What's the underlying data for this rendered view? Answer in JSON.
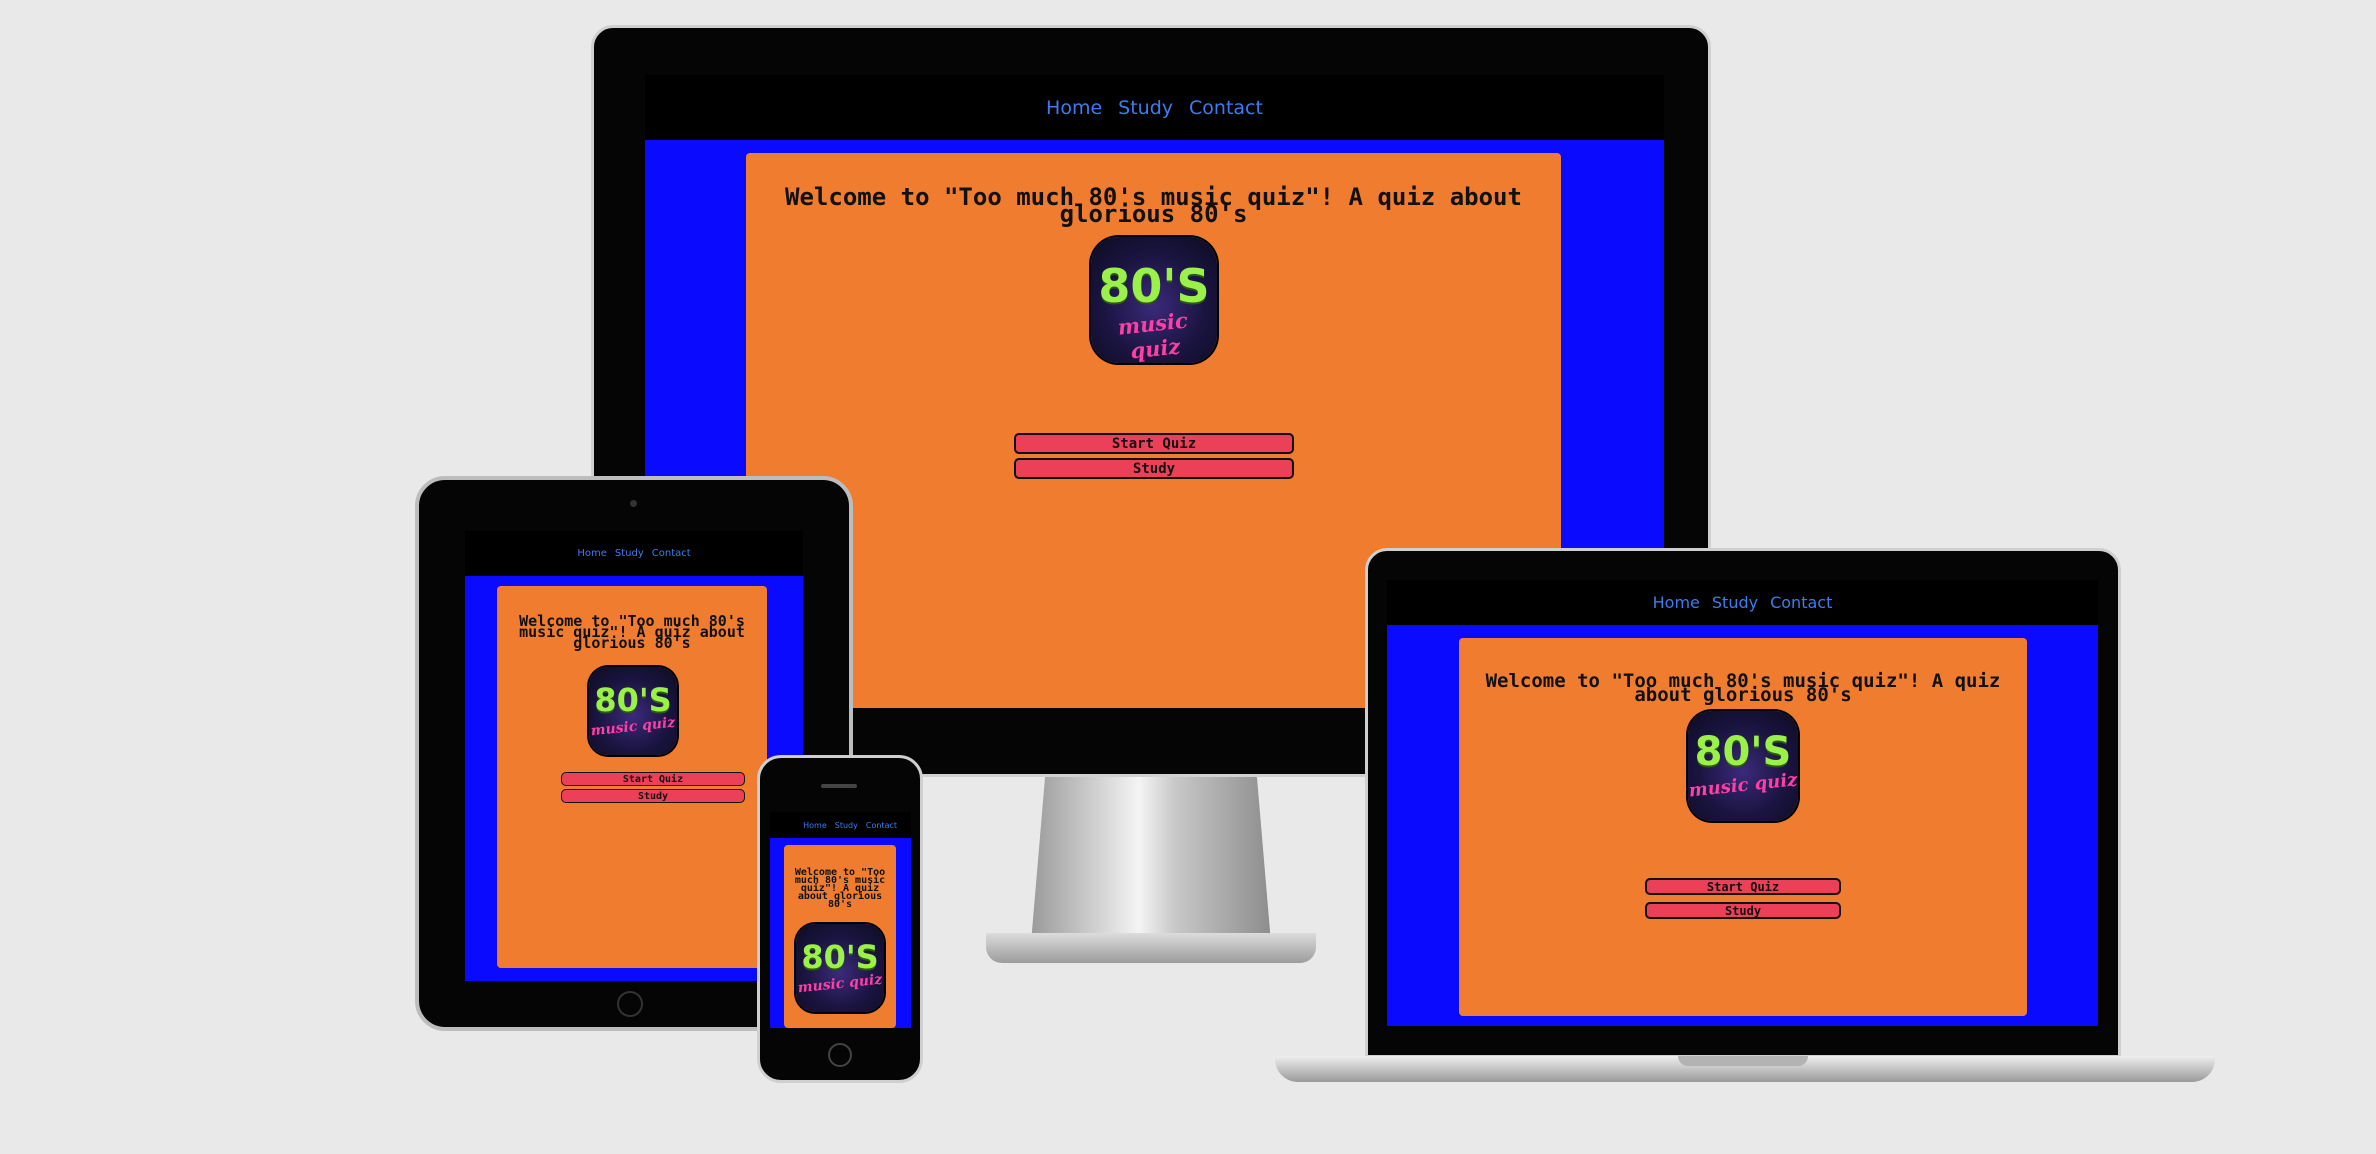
{
  "nav": {
    "home": "Home",
    "study": "Study",
    "contact": "Contact"
  },
  "page": {
    "welcome_wide": "Welcome to \"Too much 80's music quiz\"! A quiz about glorious 80's",
    "start_quiz": "Start Quiz",
    "study": "Study"
  },
  "logo": {
    "big": "80'S",
    "sub": "music quiz"
  },
  "colors": {
    "nav_bg": "#000000",
    "nav_link": "#3d7cf0",
    "page_bg": "#0a0aff",
    "card_bg": "#f07c30",
    "button_bg": "#ec3f58"
  }
}
